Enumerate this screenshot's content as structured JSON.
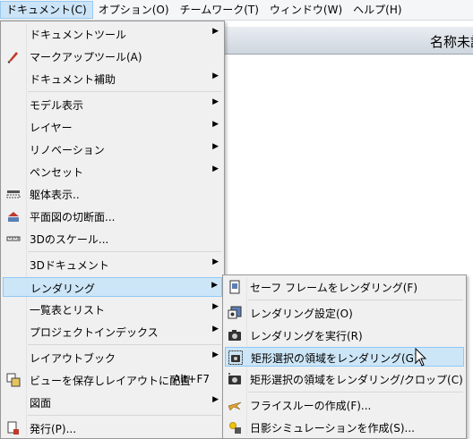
{
  "menubar": [
    "ドキュメント(C)",
    "オプション(O)",
    "チームワーク(T)",
    "ウィンドウ(W)",
    "ヘルプ(H)"
  ],
  "window_title": "名称未設",
  "document_menu": [
    {
      "label": "ドキュメントツール",
      "submenu": true
    },
    {
      "label": "マークアップツール(A)",
      "icon": "markup-tool-icon"
    },
    {
      "label": "ドキュメント補助",
      "submenu": true
    },
    {
      "label": "モデル表示",
      "submenu": true
    },
    {
      "label": "レイヤー",
      "submenu": true
    },
    {
      "label": "リノベーション",
      "submenu": true
    },
    {
      "label": "ペンセット",
      "submenu": true
    },
    {
      "label": "躯体表示..",
      "icon": "structure-display-icon"
    },
    {
      "label": "平面図の切断面...",
      "icon": "floor-plan-cut-plane-icon"
    },
    {
      "label": "3Dのスケール...",
      "icon": "3d-scale-icon"
    },
    {
      "label": "3Dドキュメント",
      "submenu": true
    },
    {
      "label": "レンダリング",
      "submenu": true,
      "highlighted": true
    },
    {
      "label": "一覧表とリスト",
      "submenu": true
    },
    {
      "label": "プロジェクトインデックス",
      "submenu": true
    },
    {
      "label": "レイアウトブック",
      "submenu": true
    },
    {
      "label": "ビューを保存しレイアウトに配置",
      "shortcut": "Alt+F7",
      "icon": "save-view-place-icon"
    },
    {
      "label": "図面",
      "submenu": true
    },
    {
      "label": "発行(P)...",
      "icon": "publish-icon"
    }
  ],
  "rendering_submenu": [
    {
      "label": "セーフ フレームをレンダリング(F)",
      "icon": "safe-frame-icon"
    },
    {
      "label": "レンダリング設定(O)",
      "icon": "rendering-settings-icon"
    },
    {
      "label": "レンダリングを実行(R)",
      "icon": "camera-icon"
    },
    {
      "label": "矩形選択の領域をレンダリング(G)",
      "icon": "camera-marquee-icon",
      "highlighted": true
    },
    {
      "label": "矩形選択の領域をレンダリング/クロップ(C)",
      "icon": "camera-crop-icon"
    },
    {
      "label": "フライスルーの作成(F)...",
      "icon": "flythrough-icon"
    },
    {
      "label": "日影シミュレーションを作成(S)...",
      "icon": "sun-study-icon"
    }
  ],
  "colors": {
    "highlight": "#cde6f7",
    "highlight_border": "#90c8f6",
    "menu_bg": "#f0f0f0"
  }
}
